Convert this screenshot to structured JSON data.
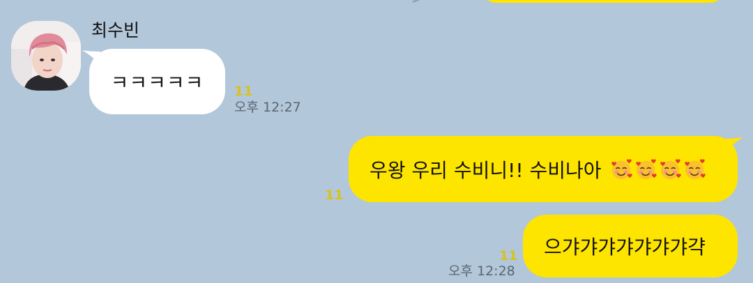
{
  "messages": {
    "incoming": {
      "sender_name": "최수빈",
      "text": "ㅋㅋㅋㅋㅋ",
      "read_count": "11",
      "time": "오후 12:27"
    },
    "outgoing_1": {
      "text": "우왕 우리 수비니!! 수비나아",
      "emoji": "smiling-face-with-hearts",
      "emoji_count": 4,
      "read_count": "11"
    },
    "outgoing_2": {
      "text": "으갸갸갸갸갸갸갸갹",
      "read_count": "11",
      "time": "오후 12:28"
    }
  },
  "colors": {
    "background": "#b2c7da",
    "outgoing_bubble": "#fee500",
    "incoming_bubble": "#ffffff",
    "read_count": "#d8c21a"
  }
}
